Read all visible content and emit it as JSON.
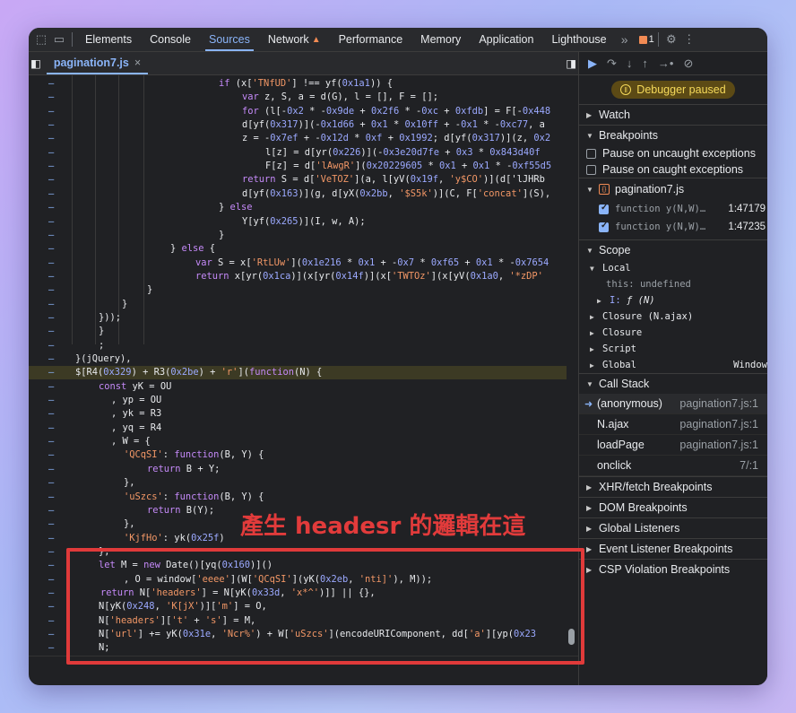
{
  "devtools_tabs": [
    "Elements",
    "Console",
    "Sources",
    "Network",
    "Performance",
    "Memory",
    "Application",
    "Lighthouse"
  ],
  "active_tab": "Sources",
  "issue_count": "1",
  "file_tab": "pagination7.js",
  "gutter_marker": "–",
  "code_lines": [
    "if (x['TNfUD'] !== yf(0x1a1)) {",
    "var z, S, a = d(G), l = [], F = [];",
    "for (l[-0x2 * -0x9de + 0x2f6 * -0xc + 0xfdb] = F[-0x448",
    "d[yf(0x317)](-0x1d66 + 0x1 * 0x10ff + -0x1 * -0xc77, a",
    "z = -0x7ef + -0x12d * 0xf + 0x1992; d[yf(0x317)](z, 0x2",
    "l[z] = d[yr(0x226)](-0x3e20d7fe + 0x3 * 0x843d40f",
    "F[z] = d['lAwgR'](0x20229605 * 0x1 + 0x1 * -0xf55d5",
    "return S = d['VeTOZ'](a, l[yV(0x19f, 'y$CO')](d['lJHRb",
    "d[yf(0x163)](g, d[yX(0x2bb, '$S5k')](C, F['concat'](S),",
    "} else",
    "Y[yf(0x265)](I, w, A);",
    "}",
    "} else {",
    "var S = x['RtLUw'](0x1e216 * 0x1 + -0x7 * 0xf65 + 0x1 * -0x7654",
    "return x[yr(0x1ca)](x[yr(0x14f)](x['TWTOz'](x[yV(0x1a0, '*zDP'",
    "}",
    "}",
    "}));",
    "}",
    ";",
    "}(jQuery),",
    "$[R4(0x329) + R3(0x2be) + 'r'](function(N) {",
    "const yK = OU",
    ", yp = OU",
    ", yk = R3",
    ", yq = R4",
    ", W = {",
    "'QCqSI': function(B, Y) {",
    "return B + Y;",
    "},",
    "'uSzcs': function(B, Y) {",
    "return B(Y);",
    "},",
    "'KjfHo': yk(0x25f)",
    "};",
    "let M = new Date()[yq(0x160)]()",
    ", O = window['eeee'](W['QCqSI'](yK(0x2eb, 'nti]'), M));",
    "return N['headers'] = N[yK(0x33d, 'x*^')]] || {},",
    "N[yK(0x248, 'K[jX')]['m'] = O,",
    "N['headers']['t' + 's'] = M,",
    "N['url'] += yK(0x31e, 'Ncr%') + W['uSzcs'](encodeURIComponent, dd['a'][yp(0x23",
    "N;",
    "})"
  ],
  "debugger_status": "Debugger paused",
  "panes": {
    "watch": "Watch",
    "breakpoints": "Breakpoints",
    "pause_uncaught": "Pause on uncaught exceptions",
    "pause_caught": "Pause on caught exceptions",
    "bp_file": "pagination7.js",
    "bp_items": [
      {
        "code": "function y(N,W)…",
        "loc": "1:47179"
      },
      {
        "code": "function y(N,W)…",
        "loc": "1:47235"
      }
    ],
    "scope": "Scope",
    "local": "Local",
    "this_label": "this:",
    "this_value": "undefined",
    "i_label": "I:",
    "i_value": "ƒ (N)",
    "closure_ajax": "Closure (N.ajax)",
    "closure": "Closure",
    "script": "Script",
    "global": "Global",
    "global_value": "Window",
    "call_stack": "Call Stack",
    "stack": [
      {
        "name": "(anonymous)",
        "loc": "pagination7.js:1"
      },
      {
        "name": "N.ajax",
        "loc": "pagination7.js:1"
      },
      {
        "name": "loadPage",
        "loc": "pagination7.js:1"
      },
      {
        "name": "onclick",
        "loc": "7/:1"
      }
    ],
    "xhr": "XHR/fetch Breakpoints",
    "dom": "DOM Breakpoints",
    "global_listeners": "Global Listeners",
    "event_listeners": "Event Listener Breakpoints",
    "csp": "CSP Violation Breakpoints"
  },
  "annotation": "產生 headesr 的邏輯在這",
  "annotation_color": "#e23b3b"
}
